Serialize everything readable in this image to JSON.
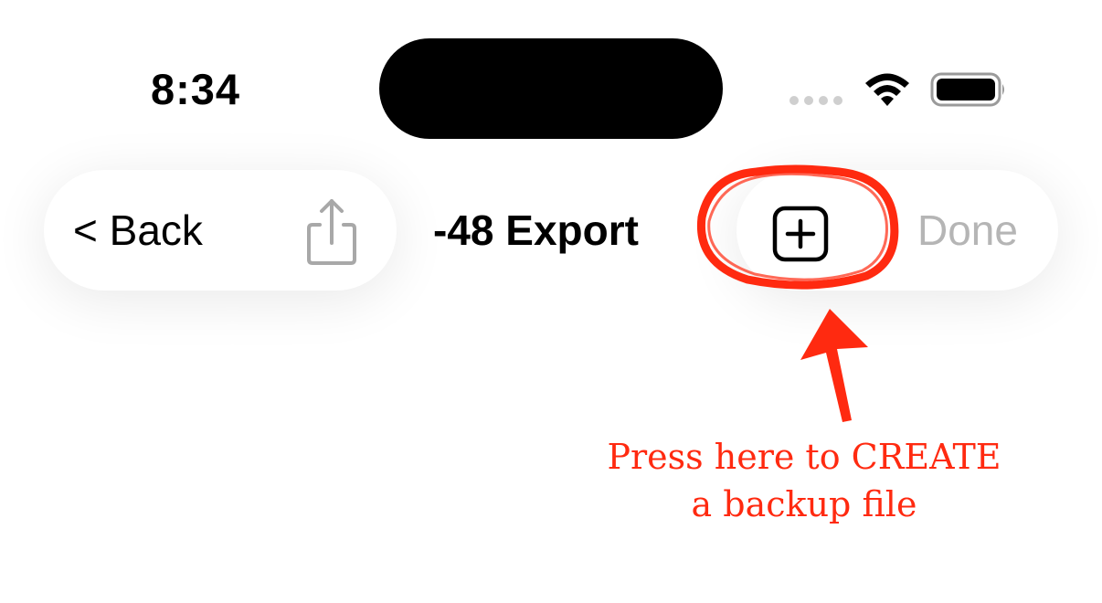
{
  "status_bar": {
    "time": "8:34",
    "icons": [
      "cellular-signal-icon",
      "wifi-icon",
      "battery-icon"
    ]
  },
  "nav_bar": {
    "back_label": "< Back",
    "title": "-48 Export",
    "done_label": "Done",
    "share_icon": "share-icon",
    "add_icon": "plus-square-icon"
  },
  "annotation": {
    "line1": "Press here to CREATE",
    "line2": "a backup file",
    "color": "#ff2a10"
  },
  "colors": {
    "background": "#ffffff",
    "done_disabled": "#b5b5b5",
    "share_icon": "#a8a8a8",
    "annotation": "#ff2a10"
  }
}
